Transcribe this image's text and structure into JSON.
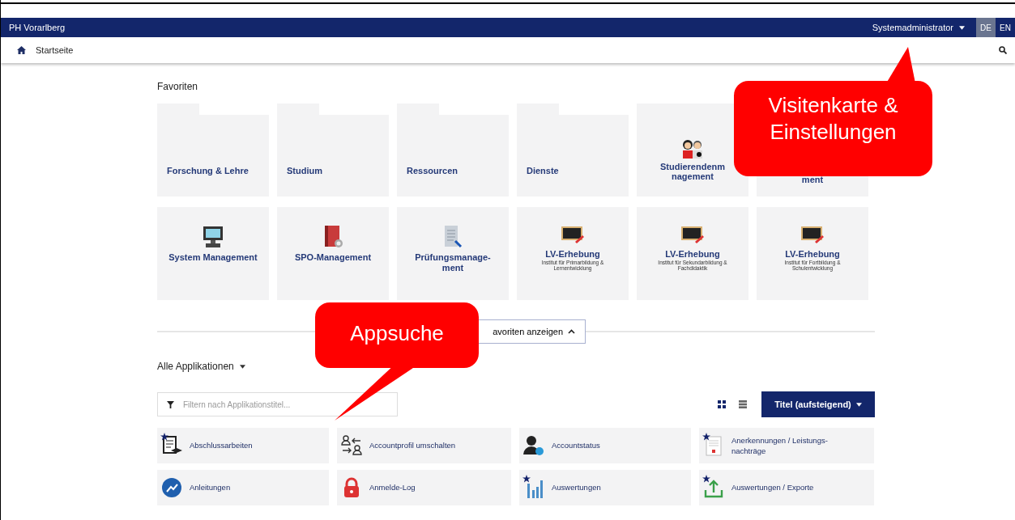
{
  "navbar": {
    "brand": "PH Vorarlberg",
    "user": "Systemadministrator",
    "languages": [
      {
        "label": "DE",
        "selected": true
      },
      {
        "label": "EN",
        "selected": false
      }
    ]
  },
  "breadcrumb": {
    "label": "Startseite"
  },
  "favorites": {
    "title": "Favoriten",
    "tiles": [
      {
        "kind": "folder",
        "label": "Forschung & Lehre"
      },
      {
        "kind": "folder",
        "label": "Studium"
      },
      {
        "kind": "folder",
        "label": "Ressourcen"
      },
      {
        "kind": "folder",
        "label": "Dienste"
      },
      {
        "kind": "app",
        "label": "Studierendenm nagement"
      },
      {
        "kind": "covered",
        "label": "ment"
      },
      {
        "kind": "app",
        "label": "System Management"
      },
      {
        "kind": "app",
        "label": "SPO-Management"
      },
      {
        "kind": "app",
        "label": "Prüfungsmanage-ment"
      },
      {
        "kind": "app",
        "label": "LV-Erhebung",
        "subtitle": "Institut für Primarbildung & Lernentwicklung"
      },
      {
        "kind": "app",
        "label": "LV-Erhebung",
        "subtitle": "Institut für Sekundarbildung & Fachdidaktik"
      },
      {
        "kind": "app",
        "label": "LV-Erhebung",
        "subtitle": "Institut für Fortbildung & Schulentwicklung"
      }
    ],
    "toggle": "avoriten anzeigen"
  },
  "applications": {
    "title": "Alle Applikationen",
    "filter": {
      "placeholder": "Filtern nach Applikationstitel..."
    },
    "views": [
      {
        "kind": "grid",
        "selected": true
      },
      {
        "kind": "list",
        "selected": false
      }
    ],
    "sort": "Titel (aufsteigend)",
    "apps": [
      {
        "label": "Abschlussarbeiten",
        "starred": true
      },
      {
        "label": "Accountprofil umschalten",
        "starred": false
      },
      {
        "label": "Accountstatus",
        "starred": false
      },
      {
        "label": "Anerkennungen / Leistungs-nachträge",
        "starred": true
      },
      {
        "label": "Anleitungen",
        "starred": false
      },
      {
        "label": "Anmelde-Log",
        "starred": false
      },
      {
        "label": "Auswertungen",
        "starred": true
      },
      {
        "label": "Auswertungen / Exporte",
        "starred": true
      }
    ]
  },
  "annotations": [
    {
      "kind": "top",
      "text": "Visitenkarte & Einstellungen"
    },
    {
      "kind": "search",
      "text": "Appsuche"
    }
  ]
}
